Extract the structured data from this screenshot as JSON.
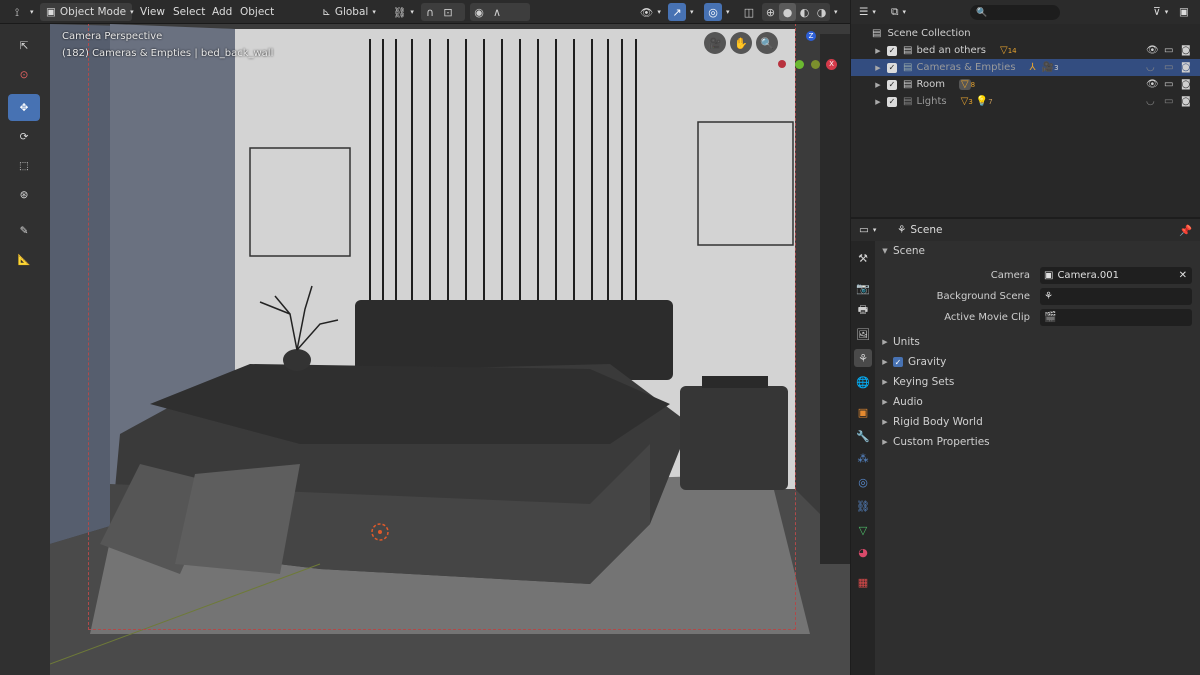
{
  "header": {
    "mode": "Object Mode",
    "menus": [
      "View",
      "Select",
      "Add",
      "Object"
    ],
    "transform_orientation": "Global"
  },
  "viewport": {
    "overlay_title": "Camera Perspective",
    "overlay_subtitle": "(182) Cameras & Empties | bed_back_wall",
    "axis_x": "X",
    "axis_z": "Z"
  },
  "outliner": {
    "search_placeholder": "",
    "root": "Scene Collection",
    "items": [
      {
        "label": "bed an others",
        "badge": "14",
        "selected": false,
        "dim": false
      },
      {
        "label": "Cameras & Empties",
        "badge": "3",
        "selected": true,
        "dim": true
      },
      {
        "label": "Room",
        "badge": "8",
        "selected": false,
        "dim": false
      },
      {
        "label": "Lights",
        "badge": "3",
        "badge2": "7",
        "selected": false,
        "dim": true
      }
    ]
  },
  "properties": {
    "context": "Scene",
    "panel": "Scene",
    "fields": {
      "camera_label": "Camera",
      "camera_value": "Camera.001",
      "background_label": "Background Scene",
      "movie_label": "Active Movie Clip"
    },
    "subpanels": [
      "Units",
      "Gravity",
      "Keying Sets",
      "Audio",
      "Rigid Body World",
      "Custom Properties"
    ]
  },
  "colors": {
    "accent": "#4772b3",
    "selection_row": "#334d80",
    "camera_frame": "#b04a4a"
  }
}
